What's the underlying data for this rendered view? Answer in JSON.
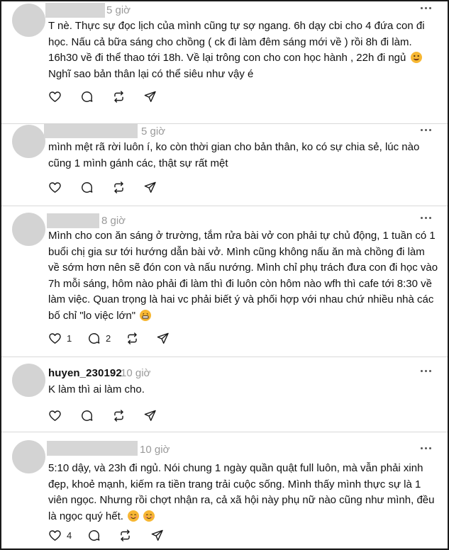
{
  "posts": [
    {
      "username": "",
      "time": "5 giờ",
      "text": "T nè. Thực sự đọc lịch của mình cũng tự sợ ngang. 6h dạy cbi cho 4 đứa con đi\nhọc. Nấu cả bữa sáng cho chồng ( ck đi làm đêm sáng mới về ) rồi 8h đi làm.\n16h30 về đi thể thao tới 18h. Về lại trông con cho con học hành , 22h đi ngủ",
      "text_tail": "\nNghĩ sao bản thân lại có thể siêu như vậy é",
      "emoji": [
        "drooling-face"
      ],
      "likes": "",
      "comments": ""
    },
    {
      "username": "",
      "time": "5 giờ",
      "text": "mình mệt rã rời luôn í, ko còn thời gian cho bản thân, ko có sự chia sẻ, lúc nào\ncũng 1 mình gánh các, thật sự rất mệt",
      "text_tail": "",
      "emoji": [],
      "likes": "",
      "comments": ""
    },
    {
      "username": "",
      "time": "8 giờ",
      "text": "Mình cho con ăn sáng ở trường, tắm rửa bài vở con phải tự chủ động, 1 tuần có 1\nbuổi chị gia sư tới hướng dẫn bài vở. Mình cũng không nấu ăn mà chồng đi làm\nvề sớm hơn nên sẽ đón con và nấu nướng. Mình chỉ phụ trách đưa con đi học vào\n7h mỗi sáng, hôm nào phải đi làm thì đi luôn còn hôm nào wfh thì cafe tới 8:30 về\nlàm việc. Quan trọng là hai vc phải biết ý và phối hợp với nhau chứ nhiều nhà các\nbố chỉ \"lo việc lớn\"",
      "text_tail": "",
      "emoji": [
        "grinning-face"
      ],
      "likes": "1",
      "comments": "2"
    },
    {
      "username": "huyen_230192",
      "time": "10 giờ",
      "text": "K làm thì ai làm cho.",
      "text_tail": "",
      "emoji": [],
      "likes": "",
      "comments": ""
    },
    {
      "username": "",
      "time": "10 giờ",
      "text": "5:10 dậy, và 23h đi ngủ. Nói chung 1 ngày quần quật full luôn, mà vẫn phải xinh\nđẹp, khoẻ mạnh, kiếm ra tiền trang trải cuộc sống. Mình thấy mình thực sự là 1\nviên ngọc. Nhưng rồi chợt nhận ra, cả xã hội này phụ nữ nào cũng như mình, đều\nlà ngọc quý hết.",
      "text_tail": "",
      "emoji": [
        "smiling-face",
        "smiling-face"
      ],
      "likes": "4",
      "comments": ""
    }
  ],
  "colors": {
    "avatar": "#d3d3d3",
    "redaction": "#d6d6d6",
    "time": "#9a9a9a",
    "divider": "#d9d9d9",
    "emoji": "#f7b733"
  }
}
